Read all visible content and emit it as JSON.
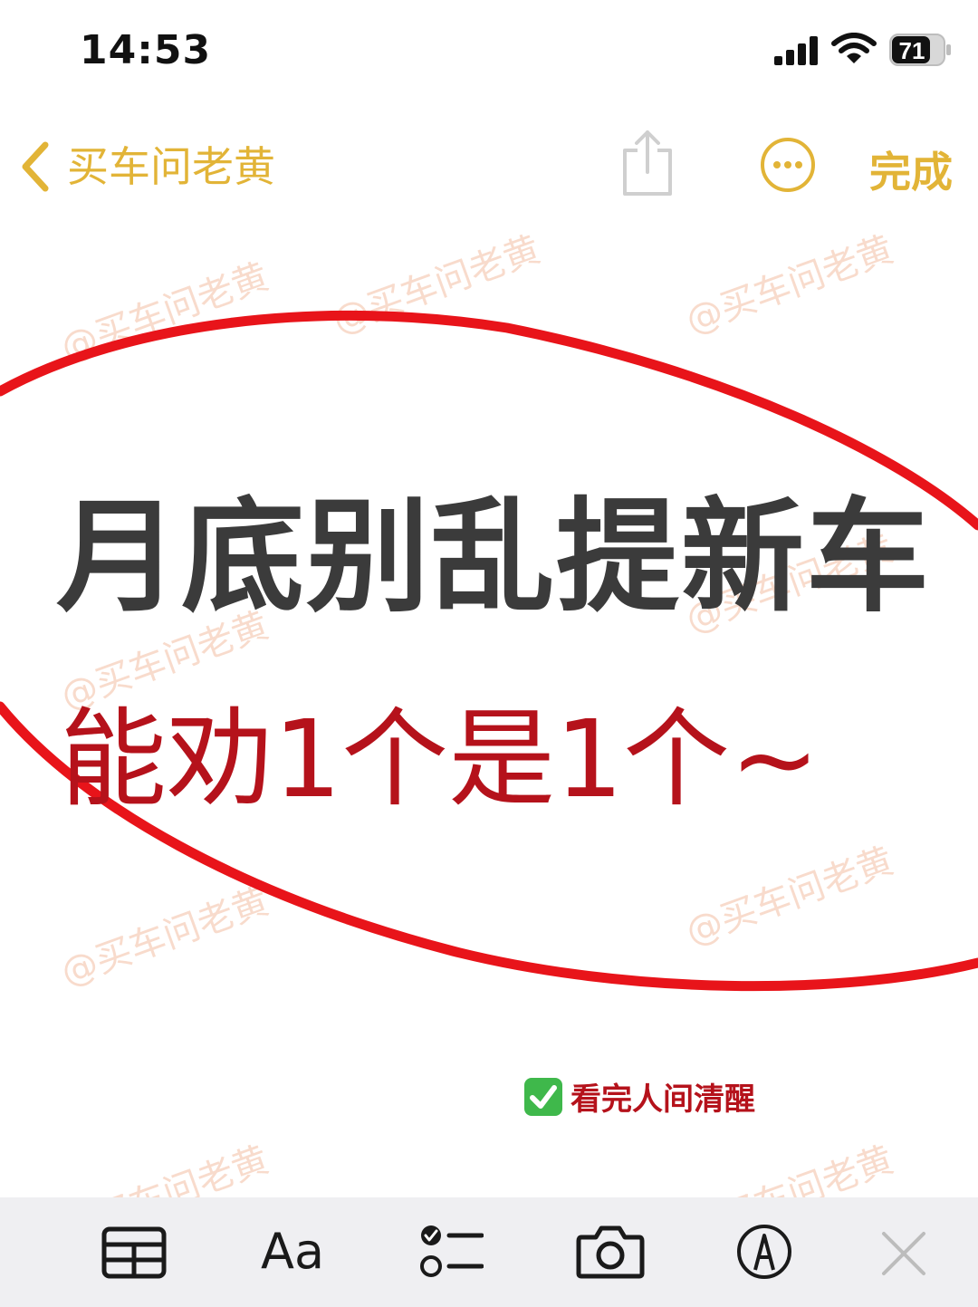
{
  "status_bar": {
    "time": "14:53",
    "battery": "71"
  },
  "nav": {
    "back_label": "买车问老黄",
    "done_label": "完成"
  },
  "watermark": {
    "text": "@买车问老黄"
  },
  "content": {
    "headline": "月底别乱提新车",
    "subline": "能劝1个是1个~",
    "tag_text": "看完人间清醒"
  },
  "toolbar": {
    "format_label": "Aa"
  },
  "colors": {
    "accent": "#e2b437",
    "headline": "#3b3b3b",
    "subline": "#b5121b",
    "ellipse": "#e8141a",
    "toolbar_bg": "#efeff2"
  }
}
